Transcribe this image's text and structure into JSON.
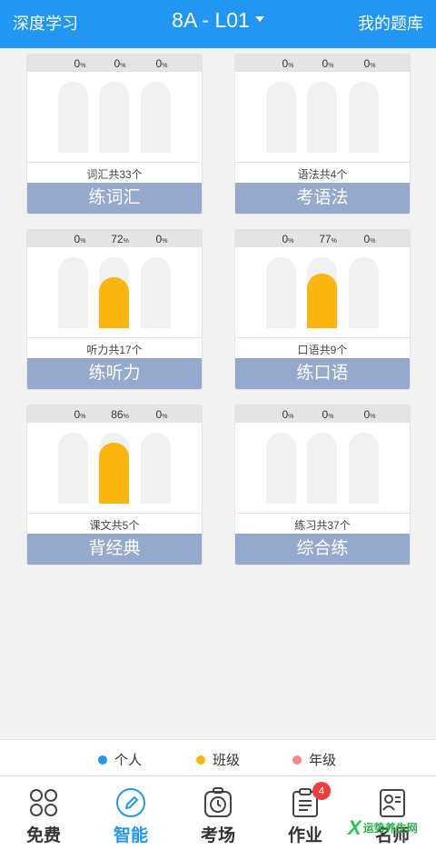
{
  "header": {
    "left": "深度学习",
    "title": "8A - L01",
    "right": "我的题库"
  },
  "pct_unit": "%",
  "cards": [
    {
      "pcts": [
        "0",
        "0",
        "0"
      ],
      "fill_pct": [
        0,
        0,
        0
      ],
      "count": "词汇共33个",
      "action": "练词汇"
    },
    {
      "pcts": [
        "0",
        "0",
        "0"
      ],
      "fill_pct": [
        0,
        0,
        0
      ],
      "count": "语法共4个",
      "action": "考语法"
    },
    {
      "pcts": [
        "0",
        "72",
        "0"
      ],
      "fill_pct": [
        0,
        72,
        0
      ],
      "count": "听力共17个",
      "action": "练听力"
    },
    {
      "pcts": [
        "0",
        "77",
        "0"
      ],
      "fill_pct": [
        0,
        77,
        0
      ],
      "count": "口语共9个",
      "action": "练口语"
    },
    {
      "pcts": [
        "0",
        "86",
        "0"
      ],
      "fill_pct": [
        0,
        86,
        0
      ],
      "count": "课文共5个",
      "action": "背经典"
    },
    {
      "pcts": [
        "0",
        "0",
        "0"
      ],
      "fill_pct": [
        0,
        0,
        0
      ],
      "count": "练习共37个",
      "action": "综合练"
    }
  ],
  "legend": [
    {
      "label": "个人",
      "color": "#2196f3"
    },
    {
      "label": "班级",
      "color": "#fbb50f"
    },
    {
      "label": "年级",
      "color": "#f28b8b"
    }
  ],
  "tabs": [
    {
      "label": "免费",
      "icon": "grid-icon"
    },
    {
      "label": "智能",
      "icon": "pencil-icon"
    },
    {
      "label": "考场",
      "icon": "clock-icon"
    },
    {
      "label": "作业",
      "icon": "clipboard-icon",
      "badge": "4"
    },
    {
      "label": "名师",
      "icon": "teacher-card-icon"
    }
  ],
  "watermark": {
    "mark": "X",
    "text": "运势养生网"
  }
}
